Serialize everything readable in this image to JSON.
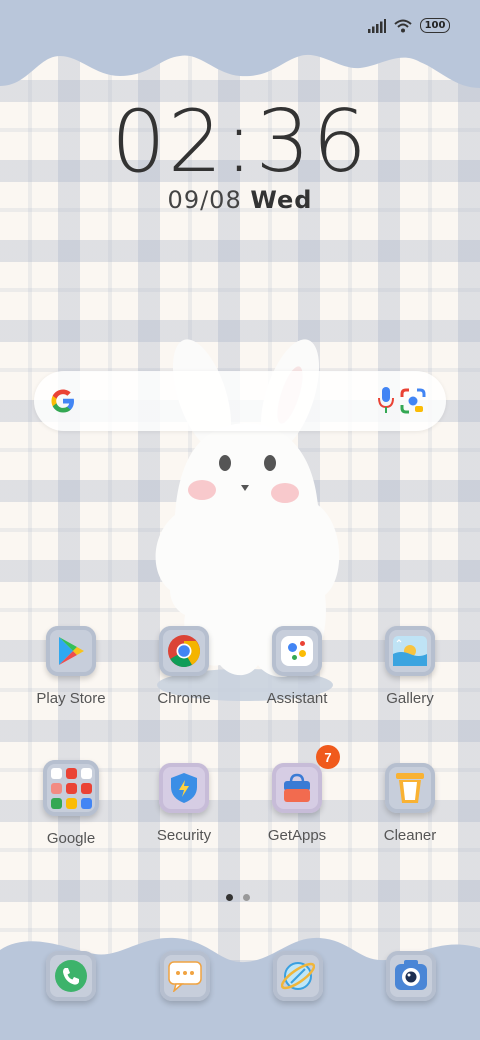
{
  "status_bar": {
    "battery": "100"
  },
  "lock": {
    "time": "02:36",
    "date": "09/08",
    "weekday": "Wed"
  },
  "search_bar": {
    "icon": "google-g-icon"
  },
  "apps_row1": [
    {
      "label": "Play Store",
      "icon": "play-store-icon"
    },
    {
      "label": "Chrome",
      "icon": "chrome-icon"
    },
    {
      "label": "Assistant",
      "icon": "assistant-icon"
    },
    {
      "label": "Gallery",
      "icon": "gallery-icon"
    }
  ],
  "apps_row2": [
    {
      "label": "Google",
      "icon": "google-folder-icon"
    },
    {
      "label": "Security",
      "icon": "security-icon"
    },
    {
      "label": "GetApps",
      "icon": "getapps-icon",
      "badge": "7"
    },
    {
      "label": "Cleaner",
      "icon": "cleaner-icon"
    }
  ],
  "page_indicator": {
    "pages": 2,
    "current": 1
  },
  "dock": [
    {
      "icon": "phone-icon"
    },
    {
      "icon": "messages-icon"
    },
    {
      "icon": "browser-icon"
    },
    {
      "icon": "camera-icon"
    }
  ],
  "colors": {
    "tile": "#c7cedb",
    "cloud": "#b9c6da",
    "badge": "#f05a1c"
  }
}
